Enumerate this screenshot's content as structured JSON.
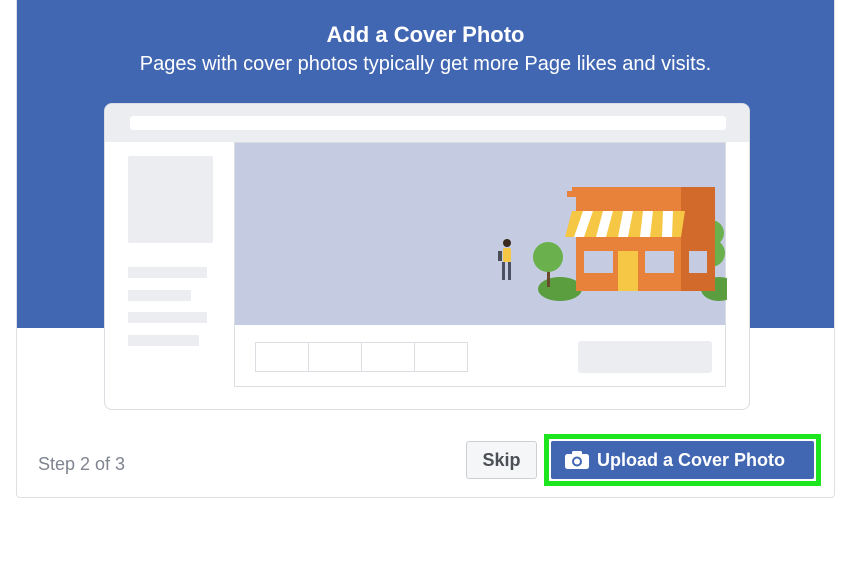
{
  "header": {
    "title": "Add a Cover Photo",
    "subtitle": "Pages with cover photos typically get more Page likes and visits."
  },
  "footer": {
    "step_text": "Step 2 of 3",
    "skip_label": "Skip",
    "upload_label": "Upload a Cover Photo",
    "upload_icon": "camera-icon"
  },
  "colors": {
    "brand_blue": "#4267b2",
    "highlight_green": "#1ee61e",
    "illustration_orange": "#e8823a",
    "illustration_yellow": "#f5c744",
    "illustration_green": "#6ab04c"
  }
}
